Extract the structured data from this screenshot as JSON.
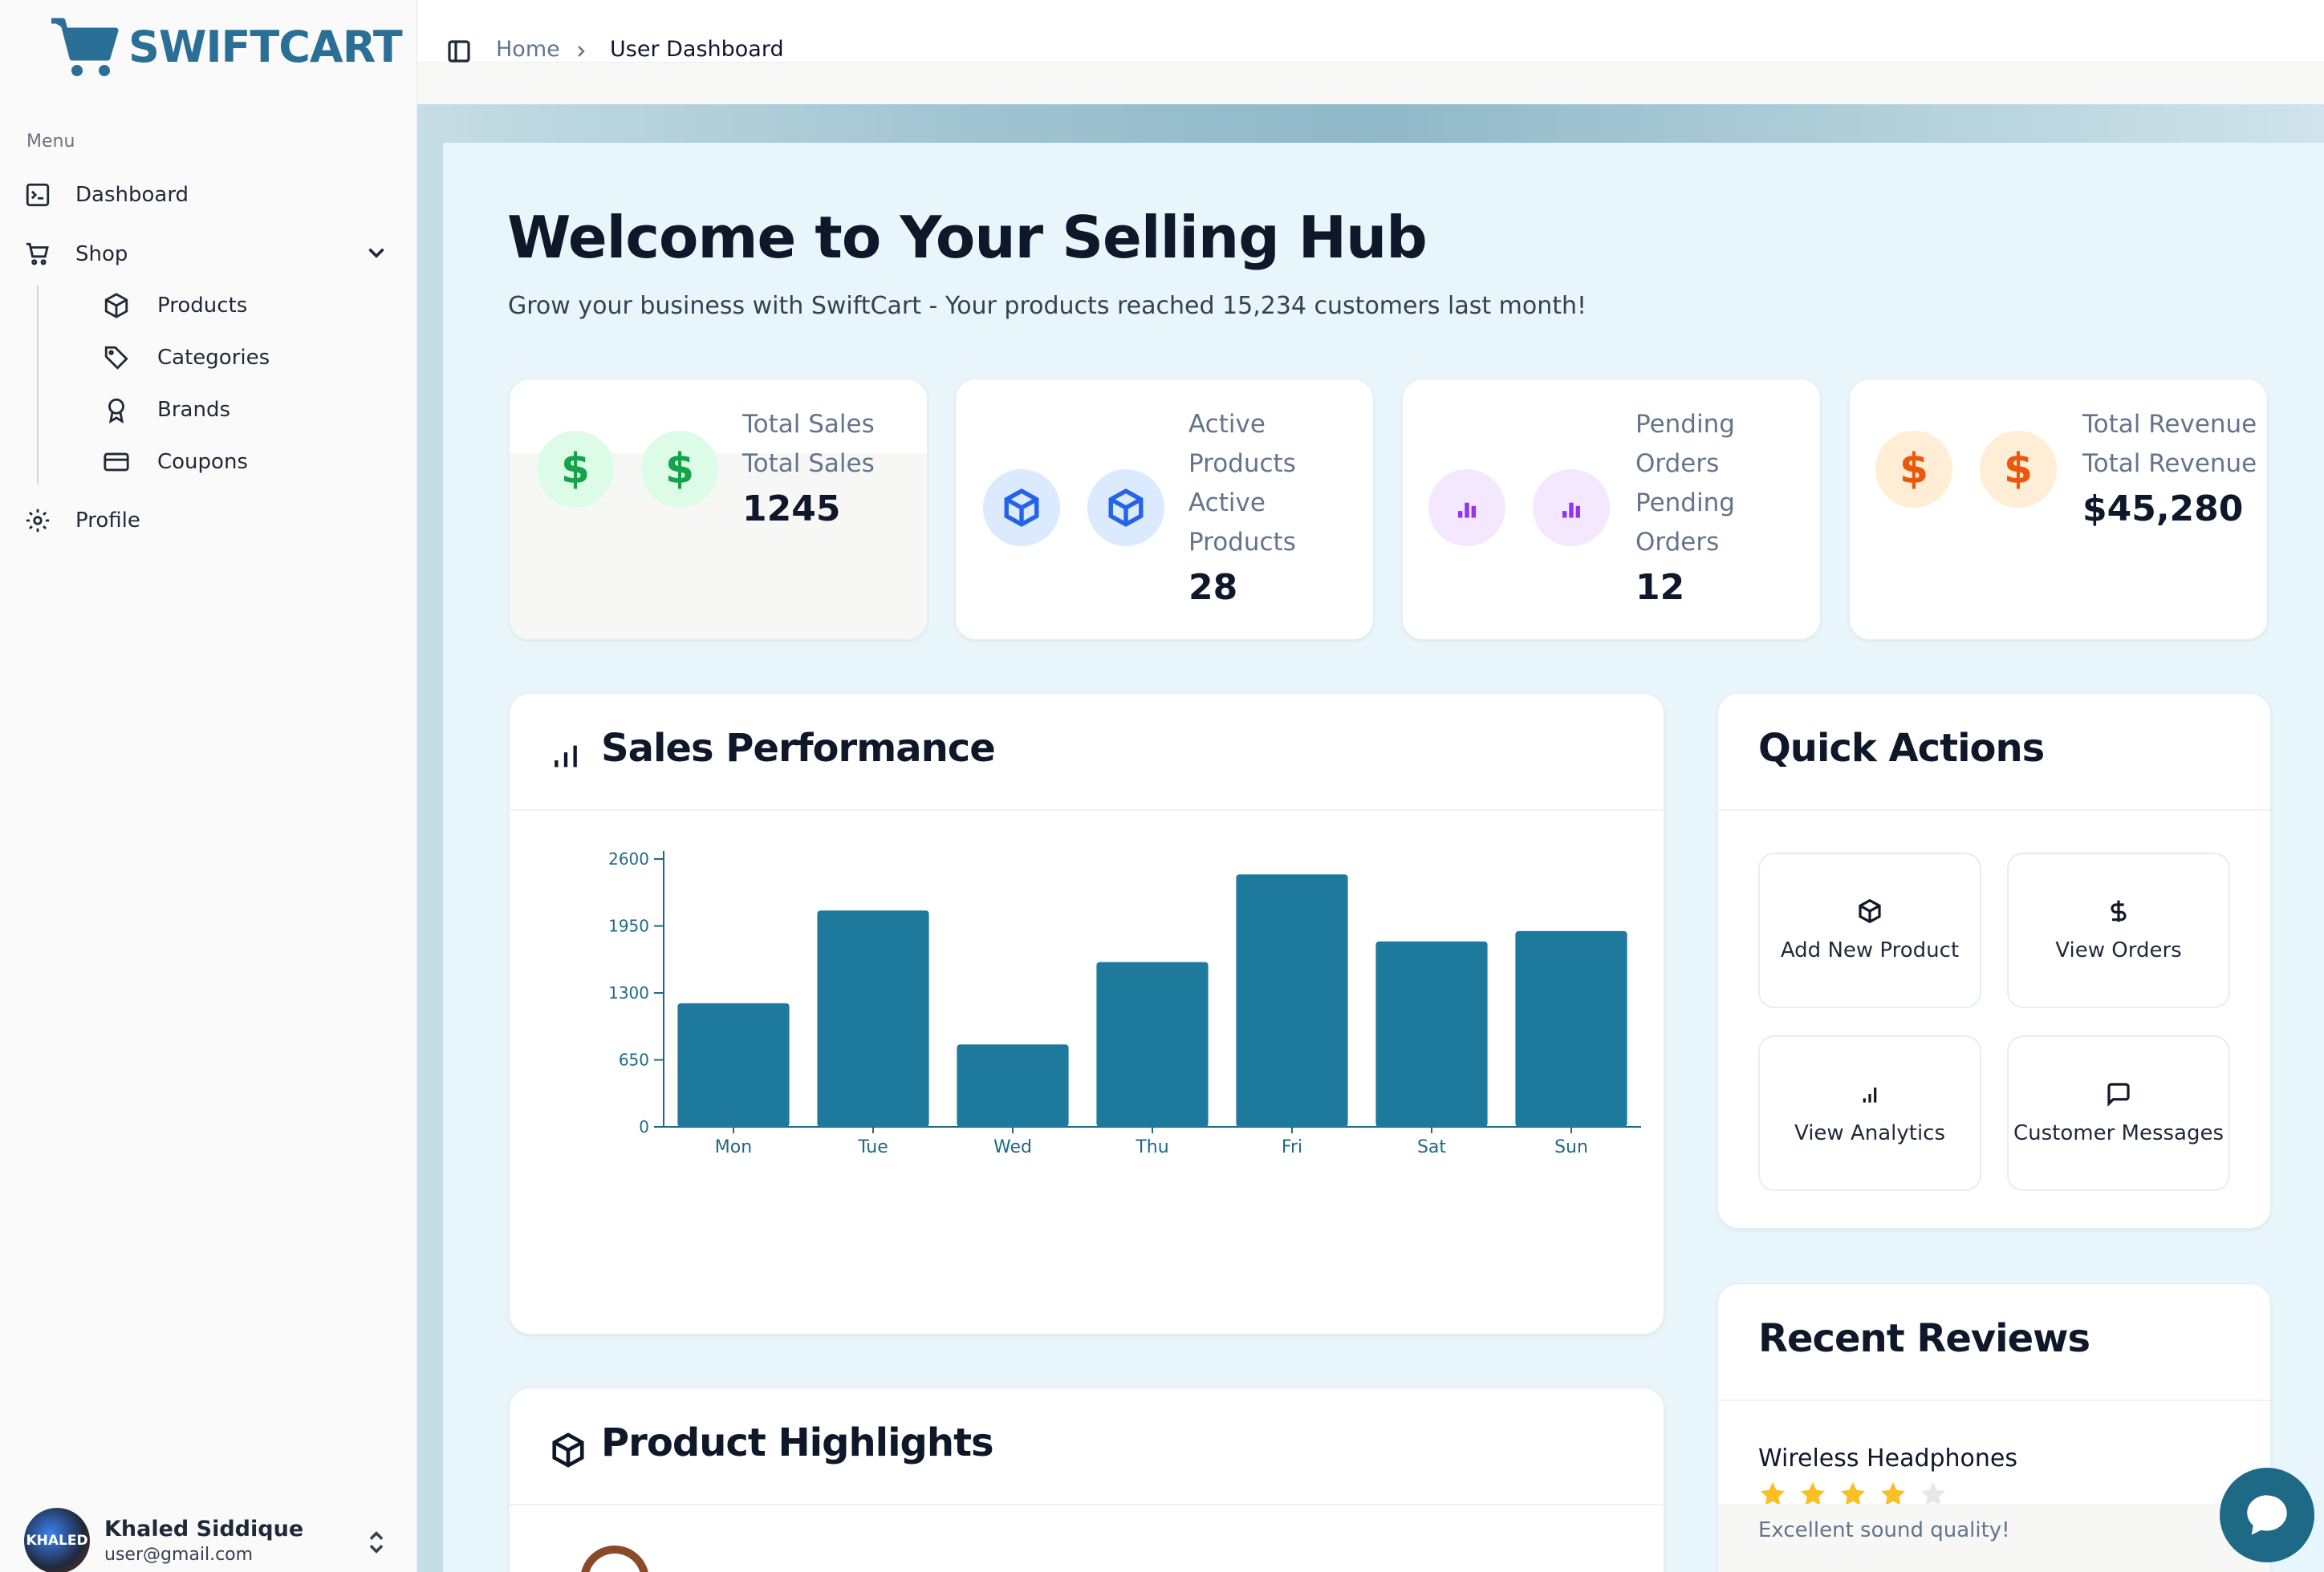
{
  "brand": {
    "name": "SWIFTCART",
    "primary": "#2a6f95"
  },
  "sidebar": {
    "menu_label": "Menu",
    "items": [
      {
        "label": "Dashboard",
        "icon": "terminal-square-icon"
      },
      {
        "label": "Shop",
        "icon": "cart-icon"
      },
      {
        "label": "Profile",
        "icon": "gear-icon"
      }
    ],
    "shop_sub": [
      {
        "label": "Products",
        "icon": "package-icon"
      },
      {
        "label": "Categories",
        "icon": "tag-icon"
      },
      {
        "label": "Brands",
        "icon": "award-icon"
      },
      {
        "label": "Coupons",
        "icon": "credit-card-icon"
      }
    ],
    "user": {
      "name": "Khaled Siddique",
      "email": "user@gmail.com",
      "avatar_text": "KHALED"
    }
  },
  "breadcrumb": {
    "home": "Home",
    "current": "User Dashboard"
  },
  "hero": {
    "title": "Welcome to Your Selling Hub",
    "subtitle": "Grow your business with SwiftCart - Your products reached 15,234 customers last month!"
  },
  "stats": [
    {
      "label": "Total Sales",
      "label2": "Total Sales",
      "value": "1245",
      "icon": "dollar-icon",
      "color": "#16a34a",
      "bg": "#dcfce7"
    },
    {
      "label": "Active Products",
      "label2": "Active Products",
      "value": "28",
      "icon": "package-icon",
      "color": "#2563eb",
      "bg": "#dbeafe"
    },
    {
      "label": "Pending Orders",
      "label2": "Pending Orders",
      "value": "12",
      "icon": "bar-chart-icon",
      "color": "#9333ea",
      "bg": "#f3e8ff"
    },
    {
      "label": "Total Revenue",
      "label2": "Total Revenue",
      "value": "$45,280",
      "icon": "dollar-icon",
      "color": "#ea580c",
      "bg": "#ffedd5"
    }
  ],
  "sales": {
    "title": "Sales Performance"
  },
  "quick_actions": {
    "title": "Quick Actions",
    "items": [
      {
        "label": "Add New Product",
        "icon": "package-icon"
      },
      {
        "label": "View Orders",
        "icon": "dollar-icon"
      },
      {
        "label": "View Analytics",
        "icon": "bar-chart-icon"
      },
      {
        "label": "Customer Messages",
        "icon": "message-square-icon"
      }
    ]
  },
  "highlights": {
    "title": "Product Highlights"
  },
  "reviews": {
    "title": "Recent Reviews",
    "items": [
      {
        "product": "Wireless Headphones",
        "rating": 4,
        "max": 5,
        "text": "Excellent sound quality!"
      }
    ]
  },
  "chart_data": {
    "type": "bar",
    "categories": [
      "Mon",
      "Tue",
      "Wed",
      "Thu",
      "Fri",
      "Sat",
      "Sun"
    ],
    "values": [
      1200,
      2100,
      800,
      1600,
      2450,
      1800,
      1900
    ],
    "yticks": [
      0,
      650,
      1300,
      1950,
      2600
    ],
    "ylim": [
      0,
      2600
    ],
    "color": "#1e7a9c",
    "grid": false
  }
}
